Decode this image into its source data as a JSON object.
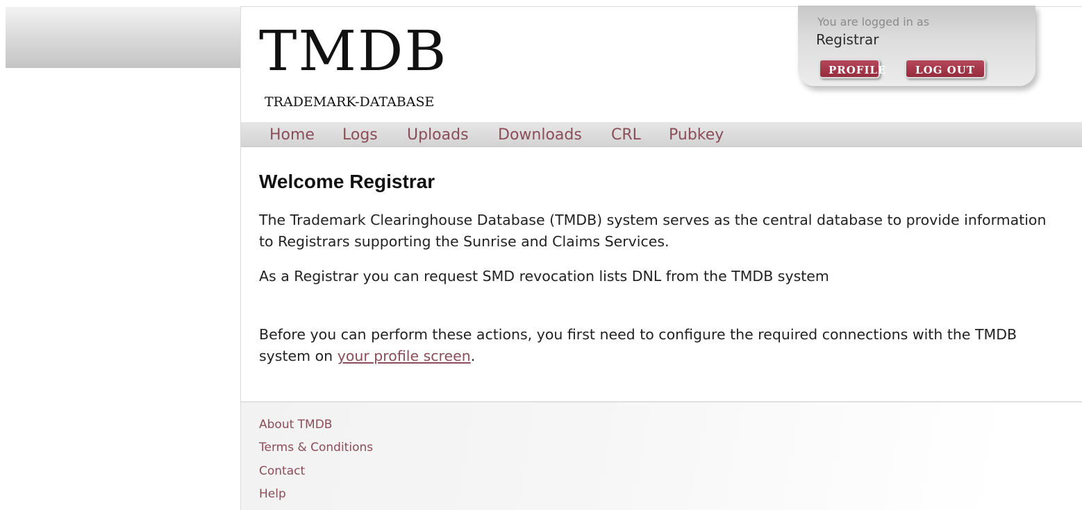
{
  "logo": {
    "main": "TMDB",
    "sub": "TRADEMARK-DATABASE"
  },
  "login": {
    "caption": "You are logged in as",
    "user": "Registrar",
    "profile_label": "PROFILE",
    "logout_label": "LOG OUT"
  },
  "nav": {
    "items": [
      {
        "label": "Home"
      },
      {
        "label": "Logs"
      },
      {
        "label": "Uploads"
      },
      {
        "label": "Downloads"
      },
      {
        "label": "CRL"
      },
      {
        "label": "Pubkey"
      }
    ]
  },
  "content": {
    "title": "Welcome Registrar",
    "paragraph1": "The Trademark Clearinghouse Database (TMDB) system serves as the central database to provide information to Registrars supporting the Sunrise and Claims Services.",
    "paragraph2": "As a Registrar you can request SMD revocation lists DNL from the TMDB system",
    "paragraph3_before": "Before you can perform these actions, you first need to configure the required connections with the TMDB system on ",
    "paragraph3_link": "your profile screen",
    "paragraph3_after": "."
  },
  "footer": {
    "links": [
      {
        "label": "About TMDB"
      },
      {
        "label": "Terms & Conditions"
      },
      {
        "label": "Contact"
      },
      {
        "label": "Help"
      }
    ]
  },
  "colors": {
    "accent_link": "#8a4d59",
    "button": "#a33a4d"
  }
}
